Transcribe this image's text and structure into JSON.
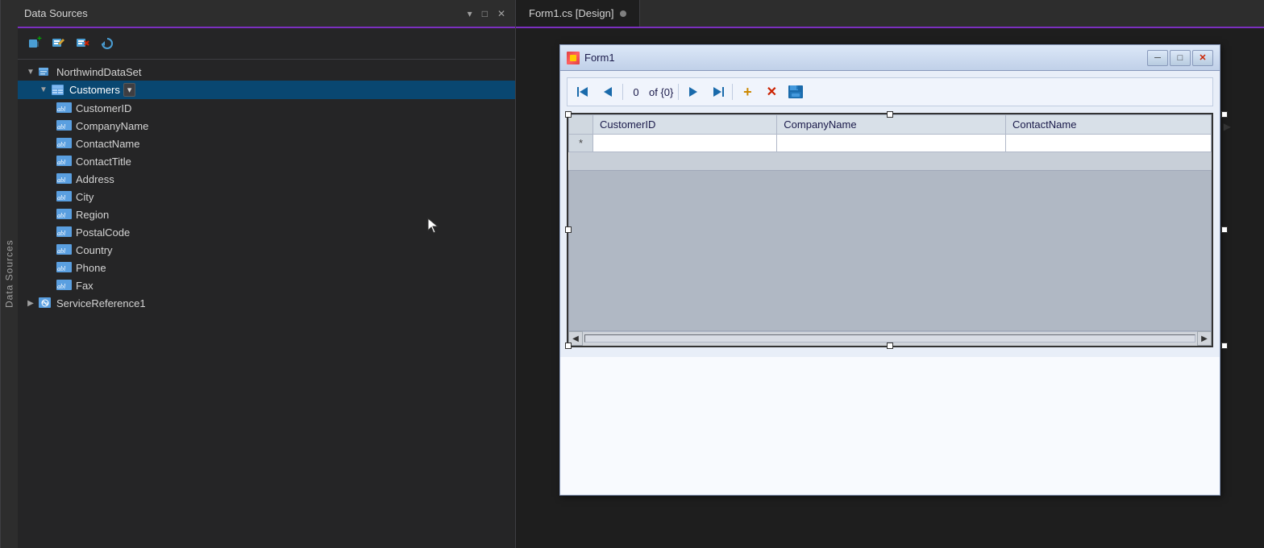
{
  "datasources_panel": {
    "title": "Data Sources",
    "tab_icons": [
      "▾",
      "□",
      "✕"
    ],
    "toolbar": {
      "add_btn": "+",
      "edit_btn": "✎",
      "refresh_btn": "↺",
      "delete_btn": "🗑"
    },
    "tree": {
      "dataset_name": "NorthwindDataSet",
      "customers_table": "Customers",
      "customers_fields": [
        "CustomerID",
        "CompanyName",
        "ContactName",
        "ContactTitle",
        "Address",
        "City",
        "Region",
        "PostalCode",
        "Country",
        "Phone",
        "Fax"
      ],
      "service_reference": "ServiceReference1"
    },
    "vertical_label": "Data Sources"
  },
  "design_panel": {
    "tab_label": "Form1.cs [Design]",
    "tab_dot_color": "#808080"
  },
  "form_window": {
    "title": "Form1",
    "navigator": {
      "first_label": "◀◀",
      "prev_label": "◀",
      "count_value": "0",
      "count_of": "of {0}",
      "next_label": "▶",
      "last_label": "▶▶",
      "add_label": "+",
      "delete_label": "✕",
      "save_label": "💾"
    },
    "grid": {
      "columns": [
        "CustomerID",
        "CompanyName",
        "ContactName"
      ],
      "new_row_marker": "*"
    }
  }
}
